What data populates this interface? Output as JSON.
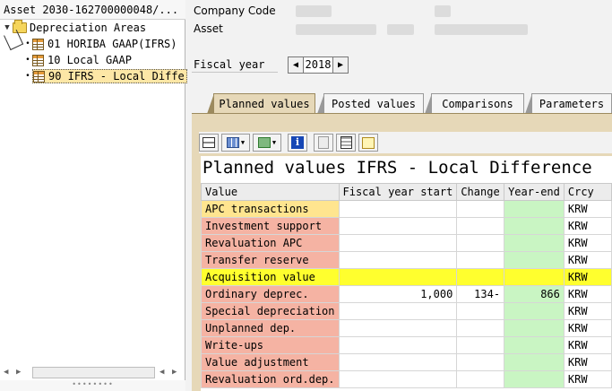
{
  "tree": {
    "title": "Asset 2030-162700000048/...",
    "root_label": "Depreciation Areas",
    "items": [
      {
        "label": "01 HORIBA GAAP(IFRS)",
        "selected": false
      },
      {
        "label": "10 Local GAAP",
        "selected": false
      },
      {
        "label": "90 IFRS - Local Diffe",
        "selected": true
      }
    ]
  },
  "header": {
    "company_code_label": "Company Code",
    "asset_label": "Asset",
    "fiscal_year_label": "Fiscal year",
    "fiscal_year_value": "2018"
  },
  "tabs": [
    {
      "label": "Planned values",
      "active": true
    },
    {
      "label": "Posted values",
      "active": false
    },
    {
      "label": "Comparisons",
      "active": false
    },
    {
      "label": "Parameters",
      "active": false
    }
  ],
  "grid": {
    "title": "Planned values IFRS - Local Difference",
    "columns": [
      "Value",
      "Fiscal year start",
      "Change",
      "Year-end",
      "Crcy"
    ],
    "rows": [
      {
        "value": "APC transactions",
        "start": "",
        "change": "",
        "year_end": "",
        "crcy": "KRW",
        "style": "highlight"
      },
      {
        "value": "Investment support",
        "start": "",
        "change": "",
        "year_end": "",
        "crcy": "KRW",
        "style": "normal"
      },
      {
        "value": "Revaluation APC",
        "start": "",
        "change": "",
        "year_end": "",
        "crcy": "KRW",
        "style": "normal"
      },
      {
        "value": "Transfer reserve",
        "start": "",
        "change": "",
        "year_end": "",
        "crcy": "KRW",
        "style": "normal"
      },
      {
        "value": "Acquisition value",
        "start": "",
        "change": "",
        "year_end": "",
        "crcy": "KRW",
        "style": "total"
      },
      {
        "value": "Ordinary deprec.",
        "start": "1,000",
        "change": "134-",
        "year_end": "866",
        "crcy": "KRW",
        "style": "normal"
      },
      {
        "value": "Special depreciation",
        "start": "",
        "change": "",
        "year_end": "",
        "crcy": "KRW",
        "style": "normal"
      },
      {
        "value": "Unplanned dep.",
        "start": "",
        "change": "",
        "year_end": "",
        "crcy": "KRW",
        "style": "normal"
      },
      {
        "value": "Write-ups",
        "start": "",
        "change": "",
        "year_end": "",
        "crcy": "KRW",
        "style": "normal"
      },
      {
        "value": "Value adjustment",
        "start": "",
        "change": "",
        "year_end": "",
        "crcy": "KRW",
        "style": "normal"
      },
      {
        "value": "Revaluation ord.dep.",
        "start": "",
        "change": "",
        "year_end": "",
        "crcy": "KRW",
        "style": "normal"
      }
    ]
  },
  "colors": {
    "label_cell": "#f5b3a3",
    "highlight_label": "#ffe58f",
    "total_row": "#ffff2e",
    "year_end_col": "#c9f5c3",
    "tab_panel": "#e6d8b8"
  }
}
